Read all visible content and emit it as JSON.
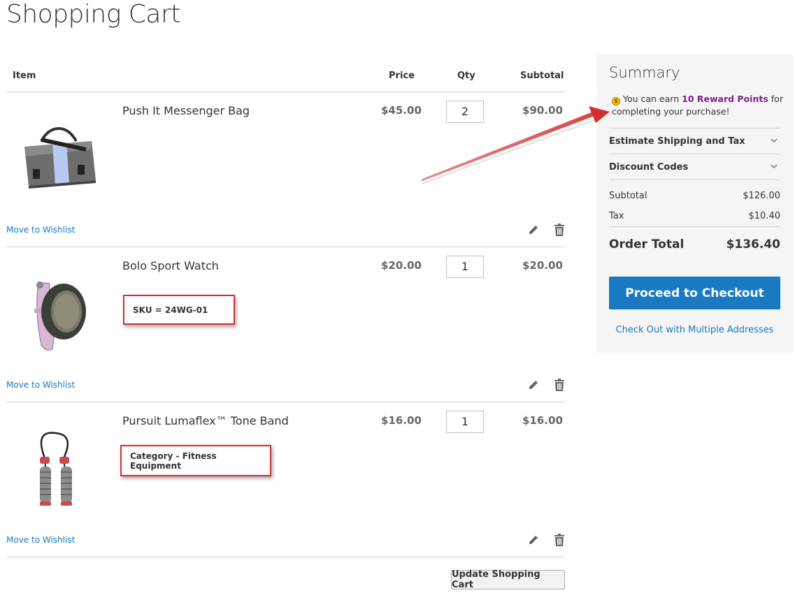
{
  "page": {
    "title": "Shopping Cart"
  },
  "cart": {
    "headers": {
      "item": "Item",
      "price": "Price",
      "qty": "Qty",
      "subtotal": "Subtotal"
    },
    "items": [
      {
        "name": "Push It Messenger Bag",
        "price": "$45.00",
        "qty": "2",
        "subtotal": "$90.00",
        "wishlist": "Move to Wishlist",
        "image_icon": "messenger-bag-image"
      },
      {
        "name": "Bolo Sport Watch",
        "price": "$20.00",
        "qty": "1",
        "subtotal": "$20.00",
        "wishlist": "Move to Wishlist",
        "image_icon": "sport-watch-image",
        "annotation": "SKU = 24WG-01"
      },
      {
        "name": "Pursuit Lumaflex™ Tone Band",
        "price": "$16.00",
        "qty": "1",
        "subtotal": "$16.00",
        "wishlist": "Move to Wishlist",
        "image_icon": "tone-band-image",
        "annotation": "Category - Fitness Equipment"
      }
    ],
    "update_button": "Update Shopping Cart"
  },
  "summary": {
    "title": "Summary",
    "reward_prefix": "You can earn",
    "reward_points": "10 Reward Points",
    "reward_suffix": "for completing your purchase!",
    "coin_symbol": "$",
    "shipping_label": "Estimate Shipping and Tax",
    "discount_label": "Discount Codes",
    "subtotal_label": "Subtotal",
    "subtotal_value": "$126.00",
    "tax_label": "Tax",
    "tax_value": "$10.40",
    "order_total_label": "Order Total",
    "order_total_value": "$136.40",
    "checkout_button": "Proceed to Checkout",
    "multi_address_link": "Check Out with Multiple Addresses"
  },
  "colors": {
    "accent": "#1979c3",
    "annotation_red": "#d32f2f",
    "reward_purple": "#7e1f8c"
  }
}
